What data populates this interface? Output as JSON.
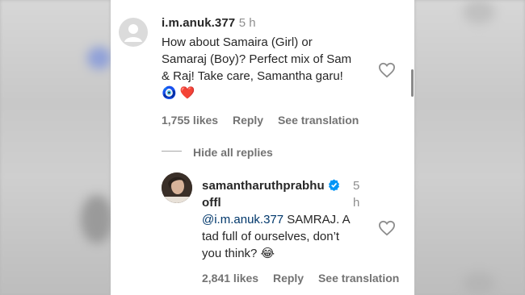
{
  "comment": {
    "username": "i.m.anuk.377",
    "time": "5 h",
    "lines": [
      "How about Samaira (Girl) or",
      "Samaraj (Boy)? Perfect mix of Sam",
      "& Raj! Take care, Samantha garu!"
    ],
    "emoji": [
      "🧿",
      "❤️"
    ],
    "likes": "1,755 likes",
    "reply": "Reply",
    "translate": "See translation"
  },
  "hide_replies": "Hide all replies",
  "reply": {
    "username_line1": "samantharuthprabhu",
    "username_line2": "offl",
    "time_line1": "5",
    "time_line2": "h",
    "mention": "@i.m.anuk.377",
    "text_line1_rest": " SAMRAJ. A",
    "text_line2": "tad full of ourselves, don’t",
    "text_line3": "you think? ",
    "emoji": "😂",
    "likes": "2,841 likes",
    "reply": "Reply",
    "translate": "See translation"
  },
  "colors": {
    "verified": "#0095f6",
    "heart_outline": "#8e8e8e",
    "mention": "#00376b"
  }
}
